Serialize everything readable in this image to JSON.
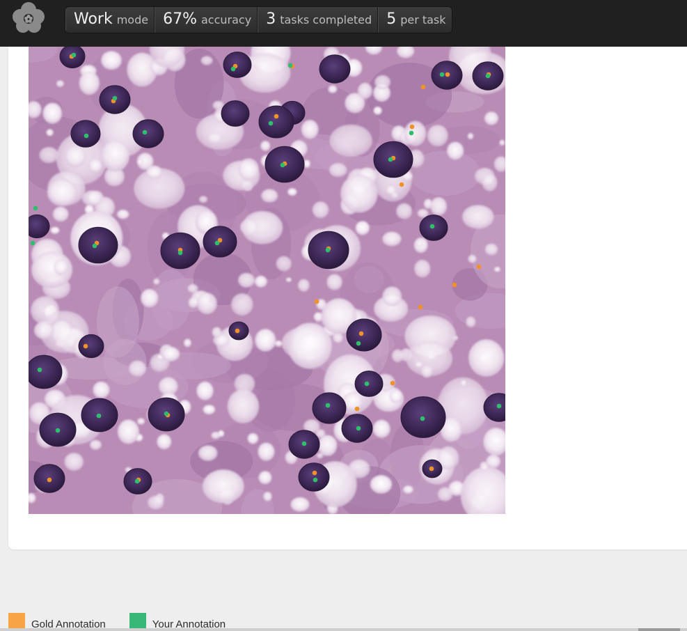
{
  "header": {
    "logo_icon": "flower-logo-icon",
    "stats": [
      {
        "value": "Work",
        "label": "mode"
      },
      {
        "value": "67%",
        "label": "accuracy"
      },
      {
        "value": "3",
        "label": "tasks completed"
      },
      {
        "value": "5",
        "label": "per task"
      }
    ]
  },
  "main": {
    "image_description_icon": "histology-tissue-image"
  },
  "legend": {
    "gold": {
      "label": "Gold Annotation",
      "color": "#f7a447"
    },
    "yours": {
      "label": "Your Annotation",
      "color": "#37b878"
    }
  },
  "colors": {
    "gold_marker": "#f0912a",
    "your_marker": "#2fbf6c"
  }
}
